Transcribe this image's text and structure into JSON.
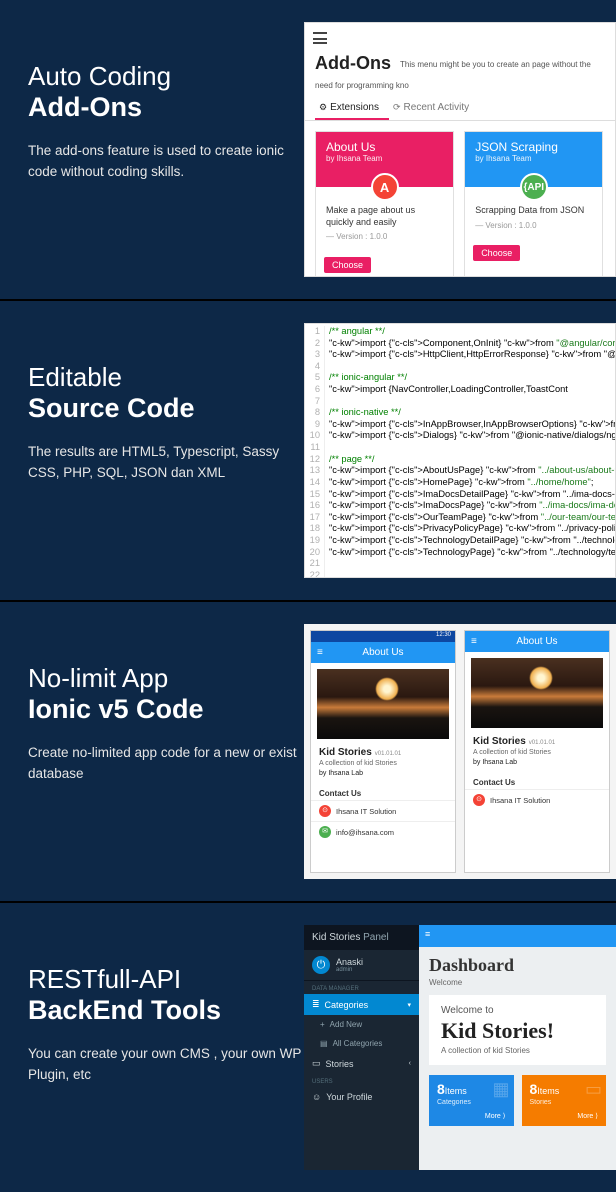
{
  "panel1": {
    "title_light": "Auto Coding",
    "title_bold": "Add-Ons",
    "desc": "The add-ons feature is used to create ionic code without coding skills.",
    "shot": {
      "page_title": "Add-Ons",
      "page_sub": "This menu might be you to create an page without the need for programming kno",
      "tabs": {
        "ext": "Extensions",
        "recent": "Recent Activity"
      },
      "card1": {
        "title": "About Us",
        "by": "by Ihsana Team",
        "badge": "A",
        "body": "Make a page about us quickly and easily",
        "ver": "— Version : 1.0.0",
        "btn": "Choose"
      },
      "card2": {
        "title": "JSON Scraping",
        "by": "by Ihsana Team",
        "badge": "{API",
        "body": "Scrapping Data from JSON",
        "ver": "— Version : 1.0.0",
        "btn": "Choose"
      }
    }
  },
  "panel2": {
    "title_light": "Editable",
    "title_bold": "Source Code",
    "desc": "The results are HTML5, Typescript, Sassy CSS, PHP, SQL, JSON dan XML",
    "lines": [
      {
        "n": 1,
        "t": "cmt",
        "s": "/** angular **/"
      },
      {
        "n": 2,
        "t": "imp",
        "s": "import {Component,OnInit} from \"@angular/core\";"
      },
      {
        "n": 3,
        "t": "imp",
        "s": "import {HttpClient,HttpErrorResponse} from \"@ang"
      },
      {
        "n": 4,
        "t": "blank",
        "s": ""
      },
      {
        "n": 5,
        "t": "cmt",
        "s": "/** ionic-angular **/"
      },
      {
        "n": 6,
        "t": "imp",
        "s": "import {NavController,LoadingController,ToastCont"
      },
      {
        "n": 7,
        "t": "blank",
        "s": ""
      },
      {
        "n": 8,
        "t": "cmt",
        "s": "/** ionic-native **/"
      },
      {
        "n": 9,
        "t": "imp",
        "s": "import {InAppBrowser,InAppBrowserOptions} from \""
      },
      {
        "n": 10,
        "t": "imp",
        "s": "import {Dialogs} from \"@ionic-native/dialogs/ngx"
      },
      {
        "n": 11,
        "t": "blank",
        "s": ""
      },
      {
        "n": 12,
        "t": "cmt",
        "s": "/** page **/"
      },
      {
        "n": 13,
        "t": "imp",
        "s": "import {AboutUsPage} from \"../about-us/about-us\""
      },
      {
        "n": 14,
        "t": "imp",
        "s": "import {HomePage} from \"../home/home\";"
      },
      {
        "n": 15,
        "t": "imp",
        "s": "import {ImaDocsDetailPage} from \"../ima-docs-det"
      },
      {
        "n": 16,
        "t": "imp",
        "s": "import {ImaDocsPage} from \"../ima-docs/ima-docs\""
      },
      {
        "n": 17,
        "t": "imp",
        "s": "import {OurTeamPage} from \"../our-team/our-team\""
      },
      {
        "n": 18,
        "t": "imp",
        "s": "import {PrivacyPolicyPage} from \"../privacy-poli"
      },
      {
        "n": 19,
        "t": "imp",
        "s": "import {TechnologyDetailPage} from \"../technolog"
      },
      {
        "n": 20,
        "t": "imp",
        "s": "import {TechnologyPage} from \"../technology/tech"
      },
      {
        "n": 21,
        "t": "blank",
        "s": ""
      },
      {
        "n": 22,
        "t": "blank",
        "s": ""
      }
    ]
  },
  "panel3": {
    "title_light": "No-limit App",
    "title_bold": "Ionic v5 Code",
    "desc": "Create no-limited app code for a new or exist database",
    "phone": {
      "status": "12:30",
      "toolbar": "About Us",
      "app_title": "Kid Stories",
      "app_ver": "v01.01.01",
      "app_desc": "A collection of kid Stories",
      "app_by": "by Ihsana Lab",
      "contact_title": "Contact Us",
      "row1": "Ihsana IT Solution",
      "row2": "info@ihsana.com"
    }
  },
  "panel4": {
    "title_light": "RESTfull-API",
    "title_bold": "BackEnd Tools",
    "desc": "You can create your own CMS , your own WP Plugin, etc",
    "dash": {
      "brand": "Kid Stories",
      "brand_sub": "Panel",
      "user": "Anaski",
      "user_role": "admin",
      "label1": "DATA MANAGER",
      "nav_cat": "Categories",
      "nav_add": "Add New",
      "nav_all": "All Categories",
      "nav_stories": "Stories",
      "label2": "USERS",
      "nav_profile": "Your Profile",
      "title": "Dashboard",
      "welcome": "Welcome",
      "card_pre": "Welcome to",
      "card_big": "Kid Stories!",
      "card_sub": "A collection of kid Stories",
      "stat_count": "8",
      "stat_unit": "Items",
      "stat1_sub": "Categories",
      "stat2_sub": "Stories",
      "more": "More ⟩"
    }
  }
}
